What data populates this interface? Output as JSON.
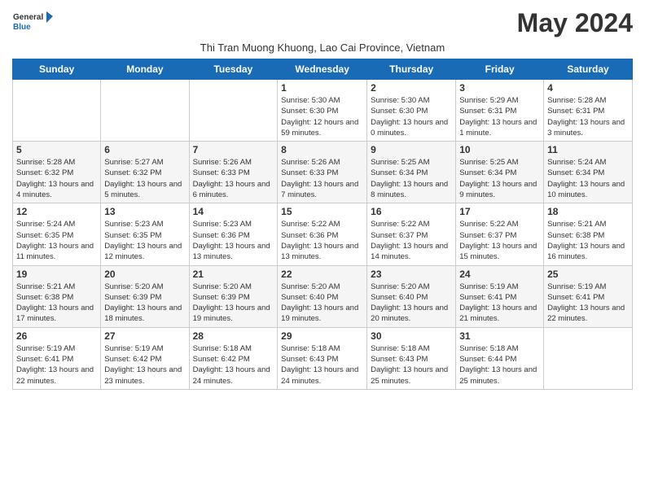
{
  "header": {
    "logo": {
      "general": "General",
      "blue": "Blue"
    },
    "title": "May 2024",
    "subtitle": "Thi Tran Muong Khuong, Lao Cai Province, Vietnam"
  },
  "weekdays": [
    "Sunday",
    "Monday",
    "Tuesday",
    "Wednesday",
    "Thursday",
    "Friday",
    "Saturday"
  ],
  "weeks": [
    [
      {
        "day": "",
        "info": ""
      },
      {
        "day": "",
        "info": ""
      },
      {
        "day": "",
        "info": ""
      },
      {
        "day": "1",
        "info": "Sunrise: 5:30 AM\nSunset: 6:30 PM\nDaylight: 12 hours and 59 minutes."
      },
      {
        "day": "2",
        "info": "Sunrise: 5:30 AM\nSunset: 6:30 PM\nDaylight: 13 hours and 0 minutes."
      },
      {
        "day": "3",
        "info": "Sunrise: 5:29 AM\nSunset: 6:31 PM\nDaylight: 13 hours and 1 minute."
      },
      {
        "day": "4",
        "info": "Sunrise: 5:28 AM\nSunset: 6:31 PM\nDaylight: 13 hours and 3 minutes."
      }
    ],
    [
      {
        "day": "5",
        "info": "Sunrise: 5:28 AM\nSunset: 6:32 PM\nDaylight: 13 hours and 4 minutes."
      },
      {
        "day": "6",
        "info": "Sunrise: 5:27 AM\nSunset: 6:32 PM\nDaylight: 13 hours and 5 minutes."
      },
      {
        "day": "7",
        "info": "Sunrise: 5:26 AM\nSunset: 6:33 PM\nDaylight: 13 hours and 6 minutes."
      },
      {
        "day": "8",
        "info": "Sunrise: 5:26 AM\nSunset: 6:33 PM\nDaylight: 13 hours and 7 minutes."
      },
      {
        "day": "9",
        "info": "Sunrise: 5:25 AM\nSunset: 6:34 PM\nDaylight: 13 hours and 8 minutes."
      },
      {
        "day": "10",
        "info": "Sunrise: 5:25 AM\nSunset: 6:34 PM\nDaylight: 13 hours and 9 minutes."
      },
      {
        "day": "11",
        "info": "Sunrise: 5:24 AM\nSunset: 6:34 PM\nDaylight: 13 hours and 10 minutes."
      }
    ],
    [
      {
        "day": "12",
        "info": "Sunrise: 5:24 AM\nSunset: 6:35 PM\nDaylight: 13 hours and 11 minutes."
      },
      {
        "day": "13",
        "info": "Sunrise: 5:23 AM\nSunset: 6:35 PM\nDaylight: 13 hours and 12 minutes."
      },
      {
        "day": "14",
        "info": "Sunrise: 5:23 AM\nSunset: 6:36 PM\nDaylight: 13 hours and 13 minutes."
      },
      {
        "day": "15",
        "info": "Sunrise: 5:22 AM\nSunset: 6:36 PM\nDaylight: 13 hours and 13 minutes."
      },
      {
        "day": "16",
        "info": "Sunrise: 5:22 AM\nSunset: 6:37 PM\nDaylight: 13 hours and 14 minutes."
      },
      {
        "day": "17",
        "info": "Sunrise: 5:22 AM\nSunset: 6:37 PM\nDaylight: 13 hours and 15 minutes."
      },
      {
        "day": "18",
        "info": "Sunrise: 5:21 AM\nSunset: 6:38 PM\nDaylight: 13 hours and 16 minutes."
      }
    ],
    [
      {
        "day": "19",
        "info": "Sunrise: 5:21 AM\nSunset: 6:38 PM\nDaylight: 13 hours and 17 minutes."
      },
      {
        "day": "20",
        "info": "Sunrise: 5:20 AM\nSunset: 6:39 PM\nDaylight: 13 hours and 18 minutes."
      },
      {
        "day": "21",
        "info": "Sunrise: 5:20 AM\nSunset: 6:39 PM\nDaylight: 13 hours and 19 minutes."
      },
      {
        "day": "22",
        "info": "Sunrise: 5:20 AM\nSunset: 6:40 PM\nDaylight: 13 hours and 19 minutes."
      },
      {
        "day": "23",
        "info": "Sunrise: 5:20 AM\nSunset: 6:40 PM\nDaylight: 13 hours and 20 minutes."
      },
      {
        "day": "24",
        "info": "Sunrise: 5:19 AM\nSunset: 6:41 PM\nDaylight: 13 hours and 21 minutes."
      },
      {
        "day": "25",
        "info": "Sunrise: 5:19 AM\nSunset: 6:41 PM\nDaylight: 13 hours and 22 minutes."
      }
    ],
    [
      {
        "day": "26",
        "info": "Sunrise: 5:19 AM\nSunset: 6:41 PM\nDaylight: 13 hours and 22 minutes."
      },
      {
        "day": "27",
        "info": "Sunrise: 5:19 AM\nSunset: 6:42 PM\nDaylight: 13 hours and 23 minutes."
      },
      {
        "day": "28",
        "info": "Sunrise: 5:18 AM\nSunset: 6:42 PM\nDaylight: 13 hours and 24 minutes."
      },
      {
        "day": "29",
        "info": "Sunrise: 5:18 AM\nSunset: 6:43 PM\nDaylight: 13 hours and 24 minutes."
      },
      {
        "day": "30",
        "info": "Sunrise: 5:18 AM\nSunset: 6:43 PM\nDaylight: 13 hours and 25 minutes."
      },
      {
        "day": "31",
        "info": "Sunrise: 5:18 AM\nSunset: 6:44 PM\nDaylight: 13 hours and 25 minutes."
      },
      {
        "day": "",
        "info": ""
      }
    ]
  ]
}
